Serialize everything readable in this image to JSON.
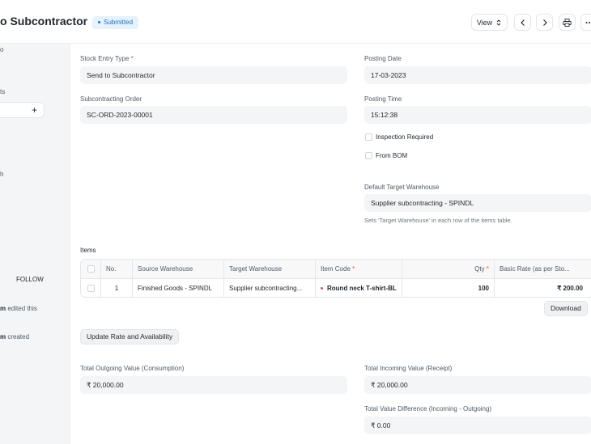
{
  "header": {
    "title": "o Subcontractor",
    "status": "Submitted",
    "view_label": "View"
  },
  "sidebar": {
    "frag1": "o",
    "frag2": "ts",
    "frag3": "h",
    "add": "+",
    "follow": "FOLLOW",
    "activity1_user": "m",
    "activity1_text": " edited this",
    "activity2_user": "m",
    "activity2_text": " created"
  },
  "form": {
    "stock_entry_type": {
      "label": "Stock Entry Type",
      "required": "*",
      "value": "Send to Subcontractor"
    },
    "posting_date": {
      "label": "Posting Date",
      "value": "17-03-2023"
    },
    "subcontracting_order": {
      "label": "Subcontracting Order",
      "value": "SC-ORD-2023-00001"
    },
    "posting_time": {
      "label": "Posting Time",
      "value": "15:12:38"
    },
    "inspection_required": {
      "label": "Inspection Required"
    },
    "from_bom": {
      "label": "From BOM"
    },
    "default_target_warehouse": {
      "label": "Default Target Warehouse",
      "value": "Supplier subcontracting - SPINDL",
      "help": "Sets 'Target Warehouse' in each row of the items table."
    }
  },
  "items": {
    "label": "Items",
    "columns": [
      "No.",
      "Source Warehouse",
      "Target Warehouse",
      "Item Code",
      "Qty",
      "Basic Rate (as per Sto..."
    ],
    "required_mark": "*",
    "row": {
      "no": "1",
      "source": "Finished Goods - SPINDL",
      "target": "Supplier subcontracting...",
      "item": "Round neck T-shirt-BL",
      "qty": "100",
      "rate": "₹ 200.00"
    },
    "download": "Download"
  },
  "actions": {
    "update_rate": "Update Rate and Availability"
  },
  "totals": {
    "outgoing": {
      "label": "Total Outgoing Value (Consumption)",
      "value": "₹ 20,000.00"
    },
    "incoming": {
      "label": "Total Incoming Value (Receipt)",
      "value": "₹ 20,000.00"
    },
    "difference": {
      "label": "Total Value Difference (Incoming - Outgoing)",
      "value": "₹ 0.00"
    }
  }
}
